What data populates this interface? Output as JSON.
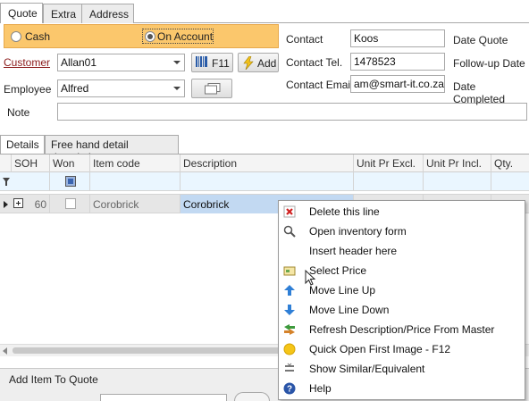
{
  "top_tabs": [
    "Quote",
    "Extra",
    "Address"
  ],
  "payment": {
    "cash": "Cash",
    "on_account": "On Account"
  },
  "customer": {
    "label": "Customer",
    "value": "Allan01"
  },
  "employee": {
    "label": "Employee",
    "value": "Alfred"
  },
  "note_label": "Note",
  "f11_label": "F11",
  "add_label": "Add",
  "contact": {
    "label": "Contact",
    "value": "Koos",
    "tel_label": "Contact Tel.",
    "tel_value": "1478523",
    "email_label": "Contact Email",
    "email_value": "am@smart-it.co.za"
  },
  "dates": {
    "quote": "Date Quote",
    "followup": "Follow-up Date",
    "completed": "Date Completed"
  },
  "detail_tabs": [
    "Details",
    "Free hand detail description"
  ],
  "grid": {
    "headers": [
      "SOH",
      "Won",
      "Item code",
      "Description",
      "Unit Pr Excl.",
      "Unit Pr Incl.",
      "Qty."
    ],
    "row": {
      "soh": "60",
      "item_code": "Corobrick",
      "description": "Corobrick"
    }
  },
  "bottom_panel": {
    "title": "Add Item To Quote"
  },
  "context_menu": [
    {
      "label": "Delete this line",
      "icon": "delete-x-icon"
    },
    {
      "label": "Open inventory form",
      "icon": "magnifier-icon"
    },
    {
      "label": "Insert header here",
      "icon": ""
    },
    {
      "label": "Select Price",
      "icon": "price-tag-icon"
    },
    {
      "label": "Move Line Up",
      "icon": "arrow-up-icon"
    },
    {
      "label": "Move Line Down",
      "icon": "arrow-down-icon"
    },
    {
      "label": "Refresh Description/Price From Master",
      "icon": "refresh-icon"
    },
    {
      "label": "Quick Open First Image - F12",
      "icon": "image-dot-icon"
    },
    {
      "label": "Show Similar/Equivalent",
      "icon": "similar-icon"
    },
    {
      "label": "Help",
      "icon": "help-icon"
    }
  ],
  "colors": {
    "payment_bar": "#fbc76c",
    "filter_row": "#eaf6ff",
    "selected_cell": "#c2d9f2",
    "customer_link": "#8b1a1a"
  }
}
